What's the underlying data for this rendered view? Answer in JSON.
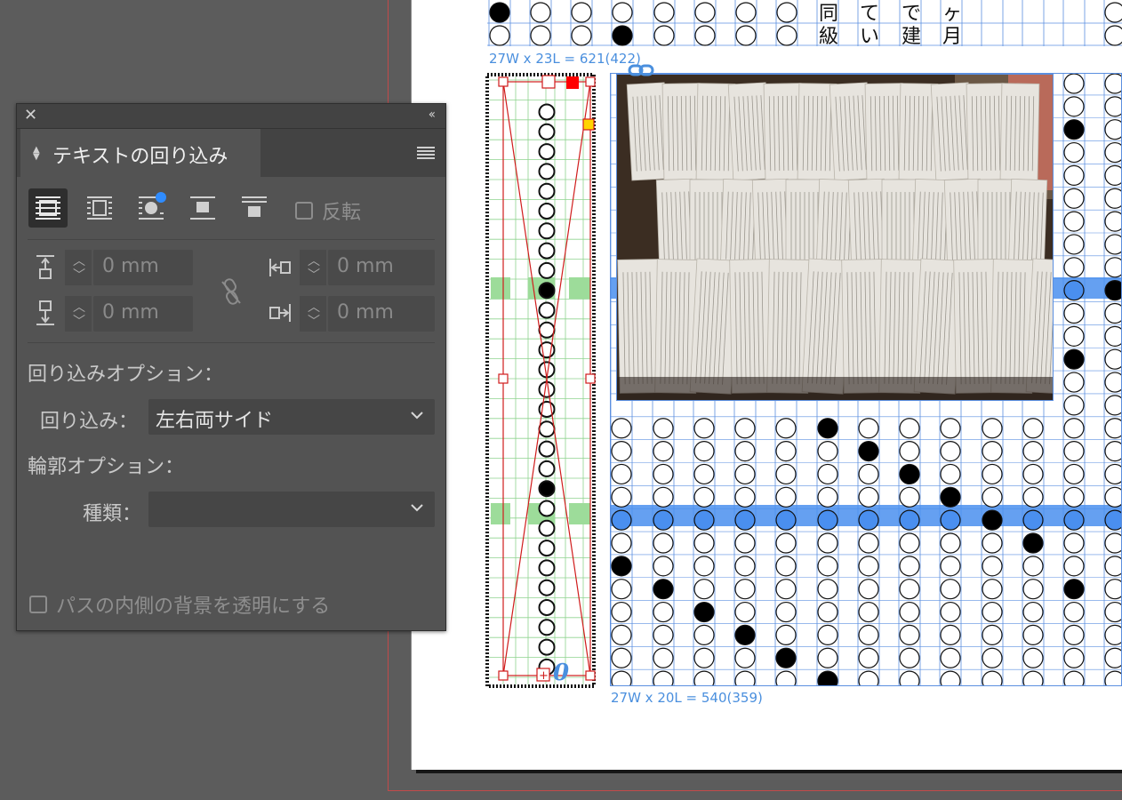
{
  "document": {
    "top_frame_label": "27W x 23L = 621(422)",
    "bottom_frame_label": "27W x 20L = 540(359)",
    "top_grid_chars": [
      "同",
      "て",
      "で",
      "ヶ",
      "級",
      "い",
      "建",
      "月"
    ],
    "overset_marker": "0"
  },
  "panel": {
    "close_glyph": "✕",
    "collapse_glyph": "‹‹",
    "tab_title": "テキストの回り込み",
    "wrap_modes": [
      {
        "icon": "no-wrap-icon",
        "active": true
      },
      {
        "icon": "wrap-around-bounding-box-icon",
        "active": false
      },
      {
        "icon": "wrap-around-object-shape-icon",
        "active": false
      },
      {
        "icon": "jump-object-icon",
        "active": false
      },
      {
        "icon": "jump-to-next-column-icon",
        "active": false
      }
    ],
    "invert_label": "反転",
    "invert_checked": false,
    "offsets": {
      "top": "0 mm",
      "bottom": "0 mm",
      "left": "0 mm",
      "right": "0 mm"
    },
    "wrap_options_heading": "回り込みオプション：",
    "wrap_to_label": "回り込み：",
    "wrap_to_value": "左右両サイド",
    "contour_options_heading": "輪郭オプション：",
    "contour_type_label": "種類：",
    "contour_type_value": "",
    "transparent_bg_label": "パスの内側の背景を透明にする",
    "transparent_bg_checked": false
  },
  "colors": {
    "pasteboard": "#5c5c5c",
    "panel_bg": "#535353",
    "panel_titlebar": "#434343",
    "frame_grid_blue": "#5b8fe0",
    "highlight_blue": "#4a8fef",
    "highlight_green": "#9ddc9a",
    "selection_red": "#d01c1c",
    "notification_dot": "#2f8cff"
  }
}
